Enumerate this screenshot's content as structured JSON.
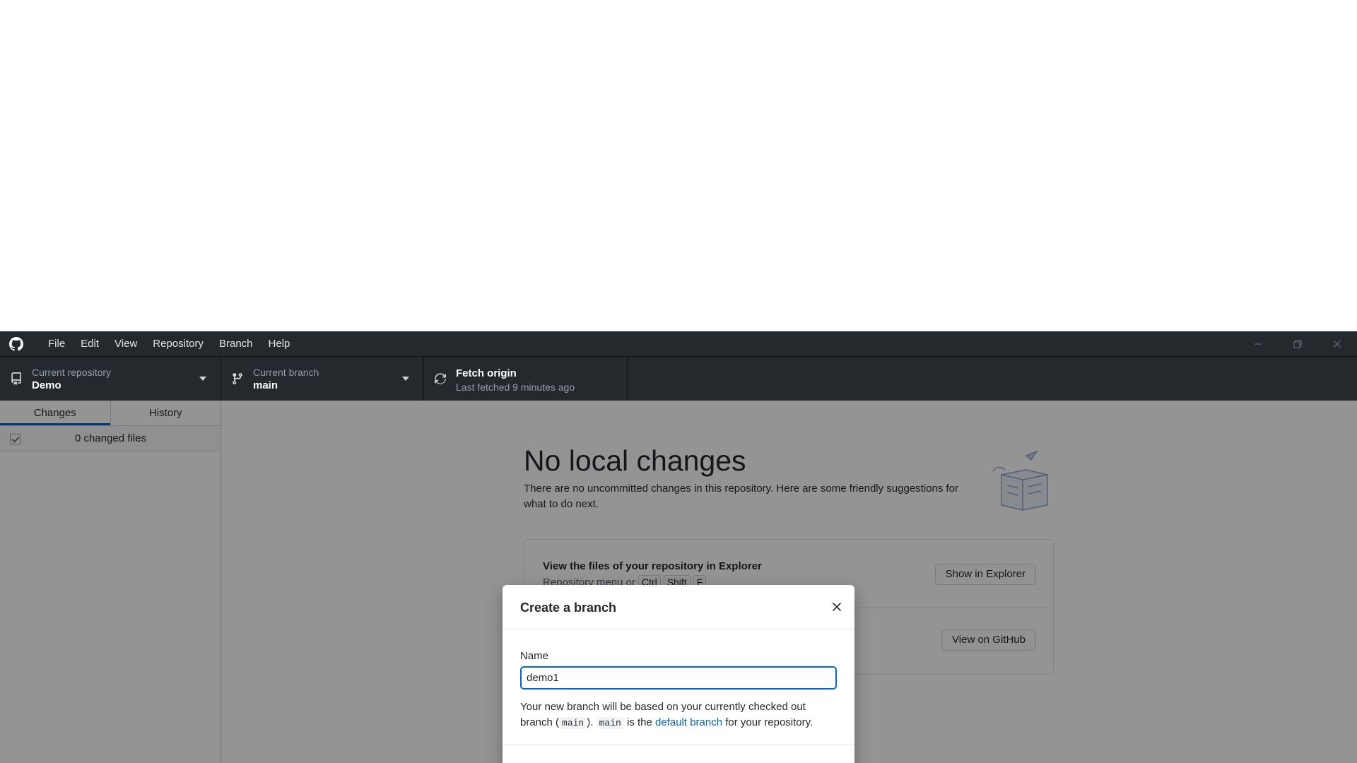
{
  "menu": [
    "File",
    "Edit",
    "View",
    "Repository",
    "Branch",
    "Help"
  ],
  "toolbar": {
    "repo": {
      "label": "Current repository",
      "value": "Demo"
    },
    "branch": {
      "label": "Current branch",
      "value": "main"
    },
    "fetch": {
      "title": "Fetch origin",
      "subtitle": "Last fetched 9 minutes ago"
    }
  },
  "sidebar": {
    "tabs": [
      "Changes",
      "History"
    ],
    "active_tab": "Changes",
    "changed_files": "0 changed files"
  },
  "main": {
    "title": "No local changes",
    "description": "There are no uncommitted changes in this repository. Here are some friendly suggestions for what to do next.",
    "suggestions": [
      {
        "title": "View the files of your repository in Explorer",
        "desc_prefix": "Repository menu or",
        "keys": [
          "Ctrl",
          "Shift",
          "F"
        ],
        "button": "Show in Explorer"
      },
      {
        "button": "View on GitHub"
      }
    ]
  },
  "dialog": {
    "title": "Create a branch",
    "name_label": "Name",
    "name_value": "demo1",
    "desc_1": "Your new branch will be based on your currently checked out branch (",
    "code_1": "main",
    "desc_2": "). ",
    "code_2": "main",
    "desc_3": " is the ",
    "link": "default branch",
    "desc_4": " for your repository."
  },
  "colors": {
    "titlebar": "#24292e",
    "accent": "#0366d6",
    "overlay": "rgba(0,0,0,0.42)"
  },
  "icons": [
    "github-logo-icon",
    "repo-icon",
    "branch-icon",
    "sync-icon",
    "caret-down-icon",
    "close-icon"
  ]
}
